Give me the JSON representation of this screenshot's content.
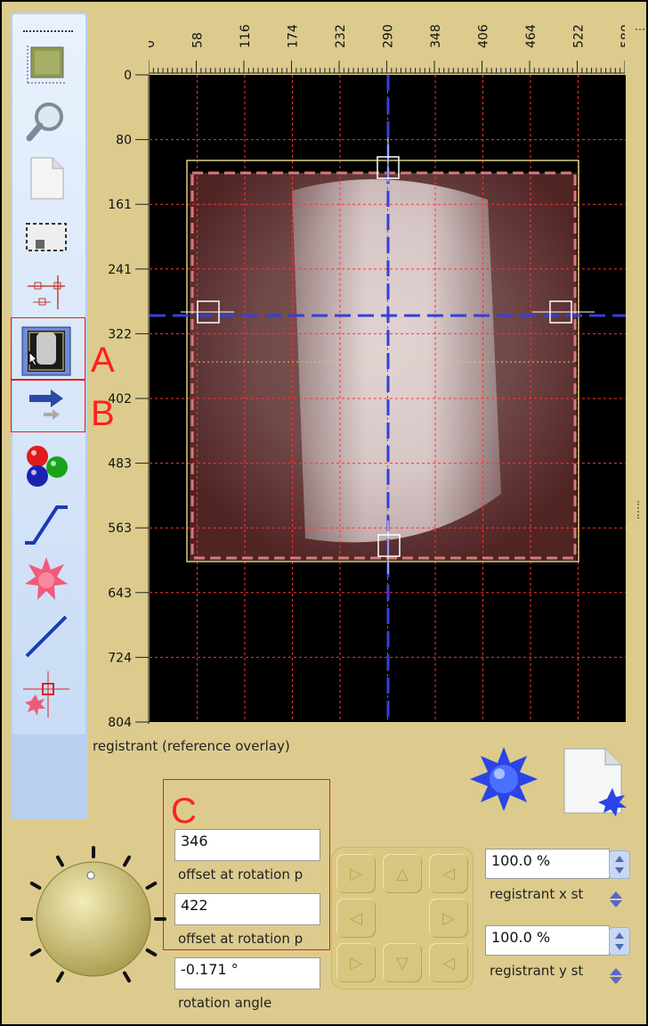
{
  "ruler": {
    "x_ticks": [
      "0",
      "58",
      "116",
      "174",
      "232",
      "290",
      "348",
      "406",
      "464",
      "522",
      "580"
    ],
    "y_ticks": [
      "0",
      "80",
      "161",
      "241",
      "322",
      "402",
      "483",
      "563",
      "643",
      "724",
      "804"
    ]
  },
  "canvas": {
    "caption": "registrant (reference overlay)"
  },
  "toolbar": {
    "items": [
      "image-thumb-icon",
      "magnifier-icon",
      "page-icon",
      "crop-select-icon",
      "point-align-icon",
      "overlay-image-icon",
      "arrows-icon",
      "color-balls-icon",
      "curve-icon",
      "star-burst-icon",
      "line-icon",
      "crosshair-star-icon"
    ]
  },
  "annotations": {
    "a": "A",
    "b": "B",
    "c": "C"
  },
  "fields": {
    "offset_x": {
      "value": "346",
      "label": "offset  at  rotation p"
    },
    "offset_y": {
      "value": "422",
      "label": "offset  at  rotation p"
    },
    "rotation": {
      "value": "-0.171 °",
      "label": "rotation angle"
    }
  },
  "scale": {
    "x": {
      "value": "100.0 %",
      "label": "registrant  x st"
    },
    "y": {
      "value": "100.0 %",
      "label": "registrant  y st"
    }
  },
  "colors": {
    "accent_red": "#e02020",
    "panel": "#dccb8d",
    "grid": "#ff3333",
    "crosshair": "#3340d8"
  }
}
